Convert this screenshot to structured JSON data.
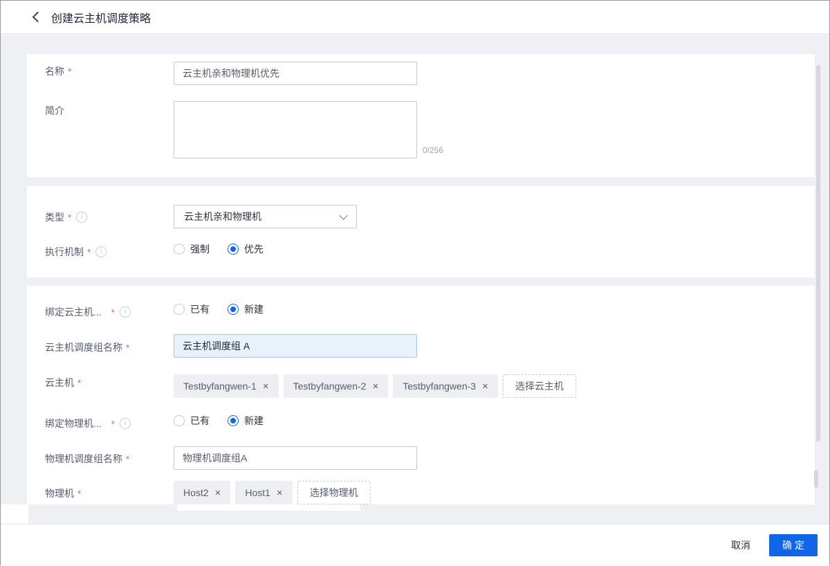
{
  "header": {
    "title": "创建云主机调度策略"
  },
  "misc": {
    "required_mark": "*"
  },
  "icons": {
    "remove": "×",
    "info": "i"
  },
  "colors": {
    "accent": "#1166e8",
    "danger": "#f25858",
    "highlight_bg": "#e8f2fd",
    "page_bg": "#eef0f4"
  },
  "basic": {
    "name_label": "名称",
    "name_value": "云主机亲和物理机优先",
    "desc_label": "简介",
    "desc_value": "",
    "desc_counter": "0/256"
  },
  "policy": {
    "type_label": "类型",
    "type_value": "云主机亲和物理机",
    "mech_label": "执行机制",
    "mech_options": [
      "强制",
      "优先"
    ],
    "mech_selected": "优先"
  },
  "binding": {
    "vm_mode_label": "绑定云主机...",
    "mode_options": [
      "已有",
      "新建"
    ],
    "vm_mode_selected": "新建",
    "vm_group_name_label": "云主机调度组名称",
    "vm_group_name_value": "云主机调度组 A",
    "vm_label": "云主机",
    "vm_tags": [
      "Testbyfangwen-1",
      "Testbyfangwen-2",
      "Testbyfangwen-3"
    ],
    "vm_select_button": "选择云主机",
    "host_mode_label": "绑定物理机...",
    "host_mode_selected": "新建",
    "host_group_name_label": "物理机调度组名称",
    "host_group_name_value": "物理机调度组A",
    "host_label": "物理机",
    "host_tags": [
      "Host2",
      "Host1"
    ],
    "host_select_button": "选择物理机"
  },
  "footer": {
    "cancel_label": "取消",
    "confirm_label": "确 定"
  }
}
